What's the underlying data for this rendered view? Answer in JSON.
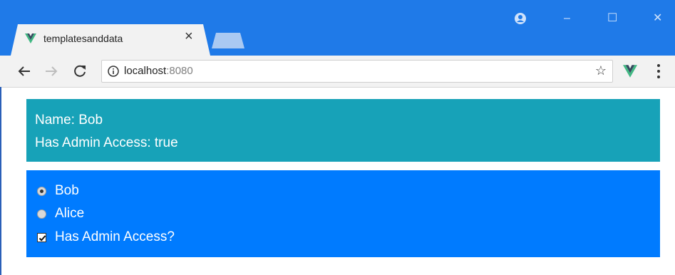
{
  "browser": {
    "tab": {
      "title": "templatesanddata",
      "close_glyph": "×",
      "icon": "vue-logo-icon"
    },
    "window_controls": {
      "minimize": "–",
      "maximize": "☐",
      "close": "✕"
    },
    "address": {
      "host": "localhost",
      "port": ":8080"
    },
    "bookmark_glyph": "☆",
    "colors": {
      "titlebar": "#1f7ae8",
      "toolbar": "#f2f2f2"
    }
  },
  "page": {
    "info_panel": {
      "name_line": "Name: Bob",
      "admin_line": "Has Admin Access: true",
      "color": "#17a2b8"
    },
    "form_panel": {
      "color": "#007bff",
      "radio_options": [
        {
          "label": "Bob",
          "checked": true
        },
        {
          "label": "Alice",
          "checked": false
        }
      ],
      "checkbox": {
        "label": "Has Admin Access?",
        "checked": true
      }
    }
  }
}
